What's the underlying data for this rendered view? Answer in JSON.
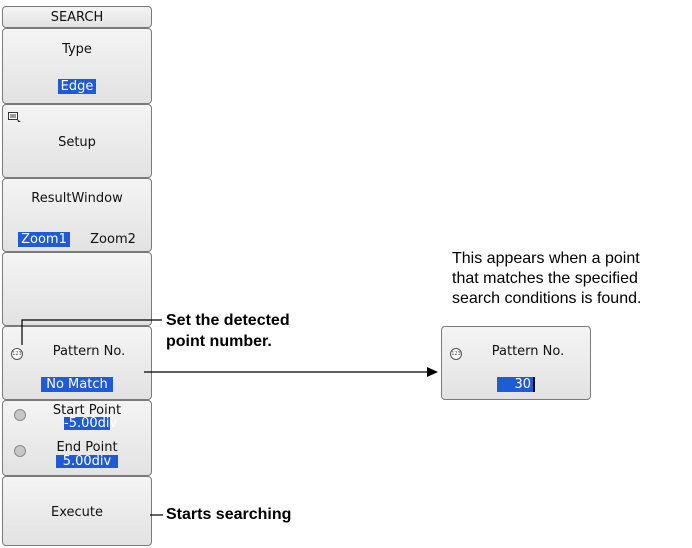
{
  "menu": {
    "title": "SEARCH",
    "type": {
      "label": "Type",
      "value": "Edge"
    },
    "setup": {
      "label": "Setup"
    },
    "result_window": {
      "label": "ResultWindow",
      "options": [
        "Zoom1",
        "Zoom2"
      ],
      "selected": "Zoom1"
    },
    "pattern": {
      "label": "Pattern No.",
      "value": "No Match",
      "icon": "123-dial-icon"
    },
    "start_point": {
      "label": "Start Point",
      "value": "-5.00div"
    },
    "end_point": {
      "label": "End Point",
      "value": "5.00div"
    },
    "execute": {
      "label": "Execute"
    }
  },
  "popup": {
    "label": "Pattern No.",
    "value": "30"
  },
  "annotations": {
    "set_point_line1": "Set the detected",
    "set_point_line2": "point number.",
    "starts_searching": "Starts searching",
    "appears_line1": "This appears when a point",
    "appears_line2": "that matches the specified",
    "appears_line3": "search conditions is found."
  }
}
